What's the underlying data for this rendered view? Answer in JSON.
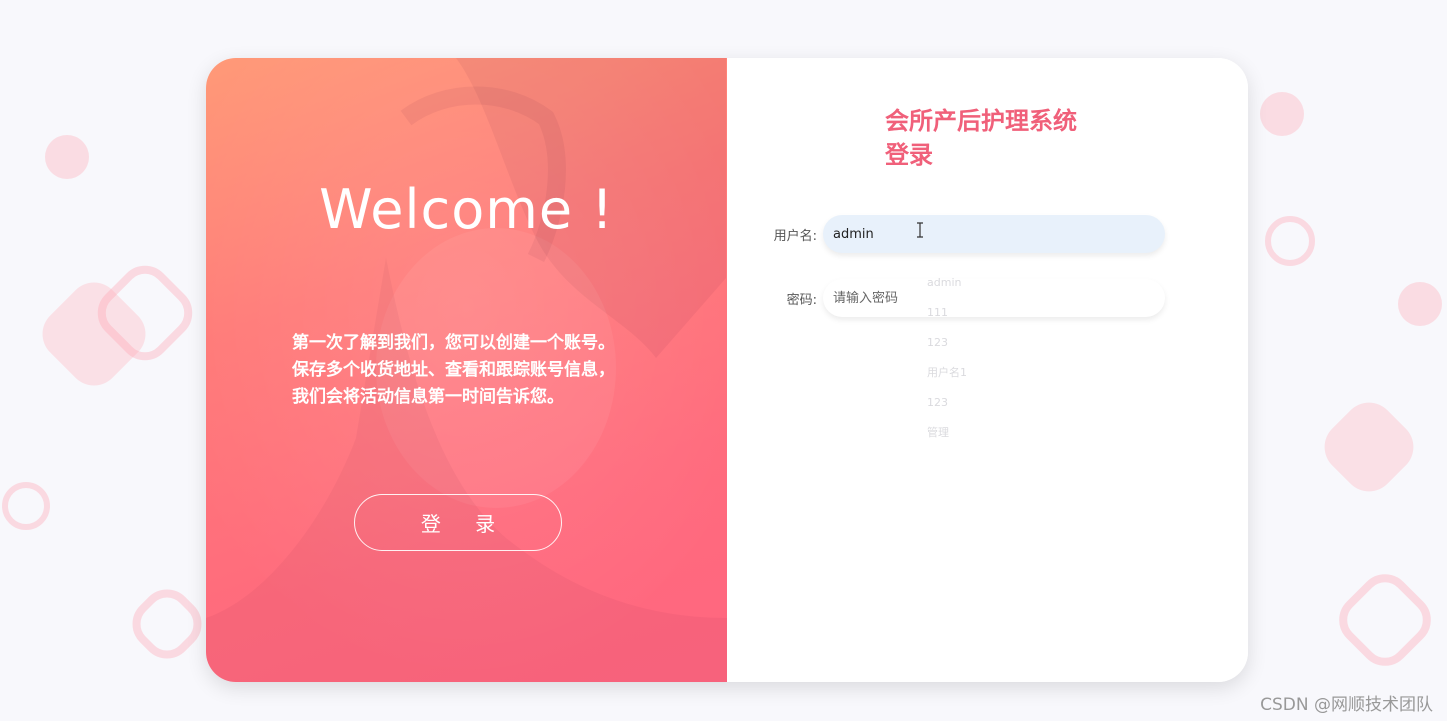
{
  "left": {
    "welcome": "Welcome !",
    "intro_lines": [
      "第一次了解到我们，您可以创建一个账号。",
      "保存多个收货地址、查看和跟踪账号信息，",
      "我们会将活动信息第一时间告诉您。"
    ],
    "login_button": "登 录"
  },
  "right": {
    "title_line1": "会所产后护理系统",
    "title_line2": "登录",
    "username_label": "用户名:",
    "username_value": "admin",
    "password_label": "密码:",
    "password_placeholder": "请输入密码",
    "autocomplete_items": [
      "admin",
      "111",
      "123",
      "用户名1",
      "123",
      "管理"
    ]
  },
  "watermark": "CSDN @网顺技术团队",
  "colors": {
    "accent": "#f0607a",
    "gradient_start": "#ff9a78",
    "gradient_end": "#ff6680",
    "active_input": "#e8f1fb"
  }
}
